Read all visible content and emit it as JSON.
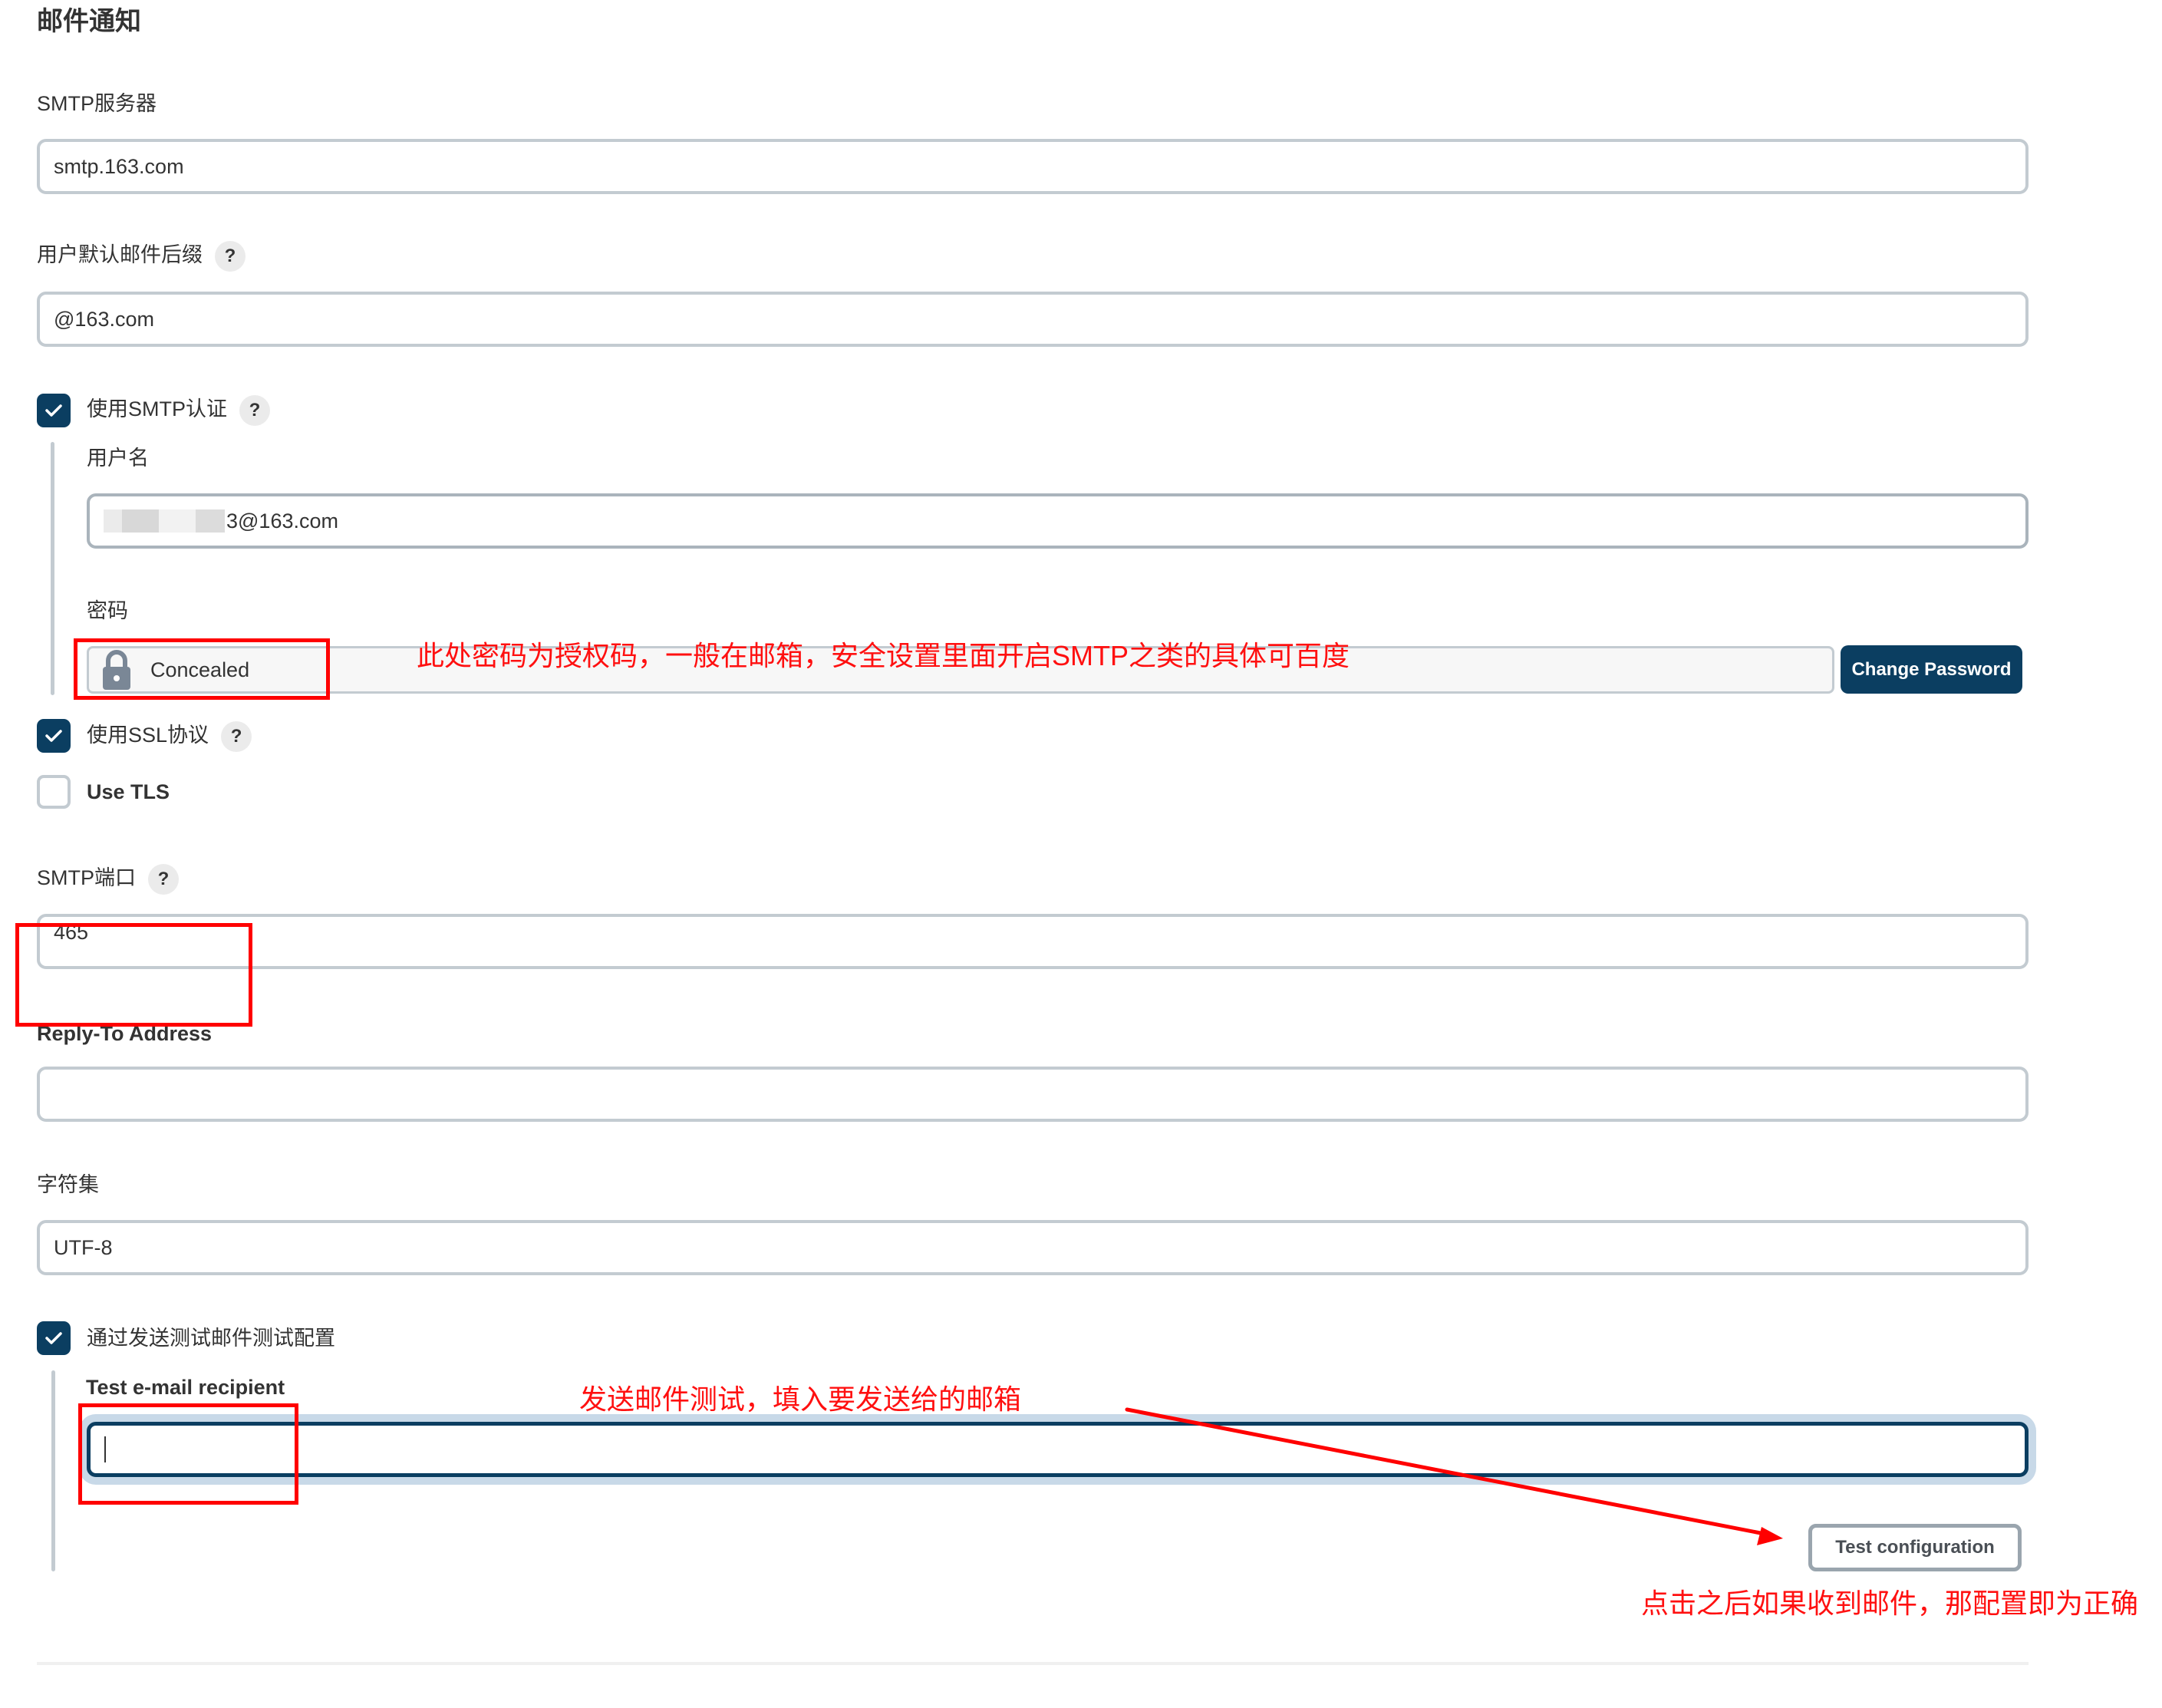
{
  "section": {
    "title": "邮件通知"
  },
  "smtp_server": {
    "label": "SMTP服务器",
    "value": "smtp.163.com"
  },
  "default_suffix": {
    "label": "用户默认邮件后缀",
    "help": "?",
    "value": "@163.com"
  },
  "smtp_auth": {
    "checked": true,
    "label": "使用SMTP认证",
    "help": "?",
    "username": {
      "label": "用户名",
      "value_visible": "3@163.com",
      "redacted": true
    },
    "password": {
      "label": "密码",
      "value": "Concealed",
      "icon": "lock-icon",
      "change_button": "Change Password"
    }
  },
  "use_ssl": {
    "checked": true,
    "label": "使用SSL协议",
    "help": "?"
  },
  "use_tls": {
    "checked": false,
    "label": "Use TLS"
  },
  "smtp_port": {
    "label": "SMTP端口",
    "help": "?",
    "value": "465"
  },
  "reply_to": {
    "label": "Reply-To Address",
    "value": ""
  },
  "charset": {
    "label": "字符集",
    "value": "UTF-8"
  },
  "test_config": {
    "checked": true,
    "label": "通过发送测试邮件测试配置",
    "recipient": {
      "label": "Test e-mail recipient",
      "value": ""
    },
    "button": "Test configuration"
  },
  "annotations": {
    "password_note": "此处密码为授权码，一般在邮箱，安全设置里面开启SMTP之类的具体可百度",
    "recipient_note": "发送邮件测试，填入要发送给的邮箱",
    "result_note": "点击之后如果收到邮件，那配置即为正确"
  },
  "colors": {
    "primary": "#0b3e61",
    "annotation": "#ff0000",
    "input_border": "#c3cbd1"
  }
}
